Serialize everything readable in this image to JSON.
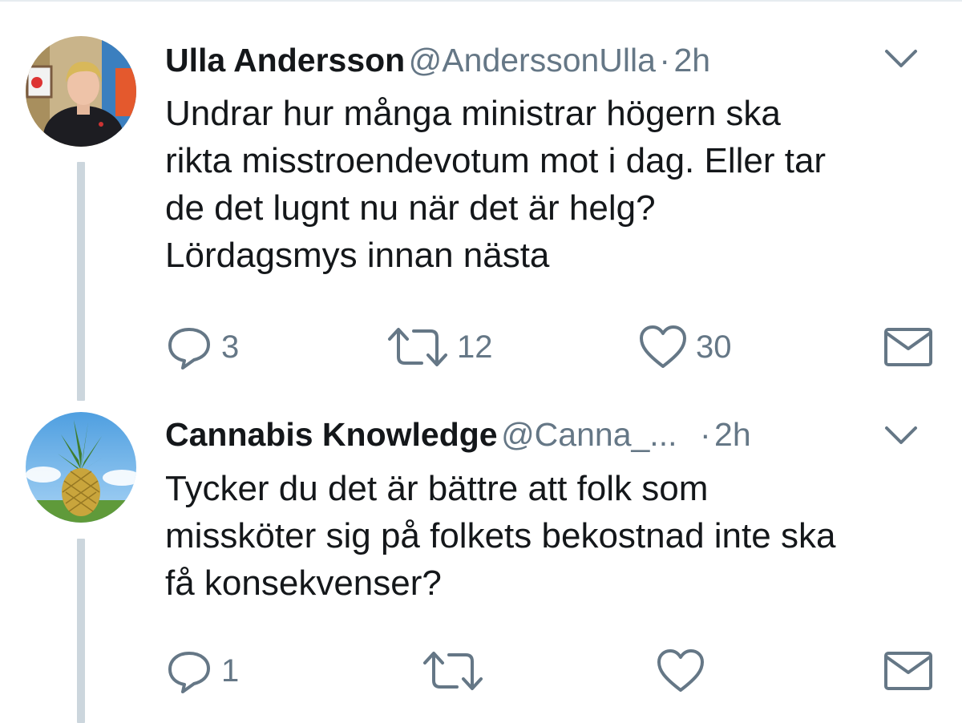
{
  "tweets": [
    {
      "name": "Ulla Andersson",
      "handle": "@AnderssonUlla",
      "separator": "·",
      "time": "2h",
      "text_lines": [
        "Undrar hur många ministrar högern ska",
        "rikta misstroendevotum mot i dag. Eller tar",
        "de det lugnt nu när det är helg?",
        "Lördagsmys innan nästa"
      ],
      "reply_count": "3",
      "retweet_count": "12",
      "like_count": "30",
      "avatar_icon": "person-portrait-avatar"
    },
    {
      "name": "Cannabis Knowledge",
      "handle": "@Canna_...",
      "separator": "·",
      "time": "2h",
      "text_lines": [
        "Tycker du det är bättre att folk som",
        "missköter sig på folkets bekostnad inte ska",
        "få konsekvenser?"
      ],
      "reply_count": "1",
      "retweet_count": "",
      "like_count": "",
      "avatar_icon": "pineapple-avatar"
    }
  ],
  "icons": {
    "reply": "reply-icon",
    "retweet": "retweet-icon",
    "like": "heart-icon",
    "message": "envelope-icon",
    "more": "chevron-down-icon"
  },
  "colors": {
    "icon_gray": "#657786",
    "thread_line": "#ccd6dd",
    "text": "#14171a"
  }
}
